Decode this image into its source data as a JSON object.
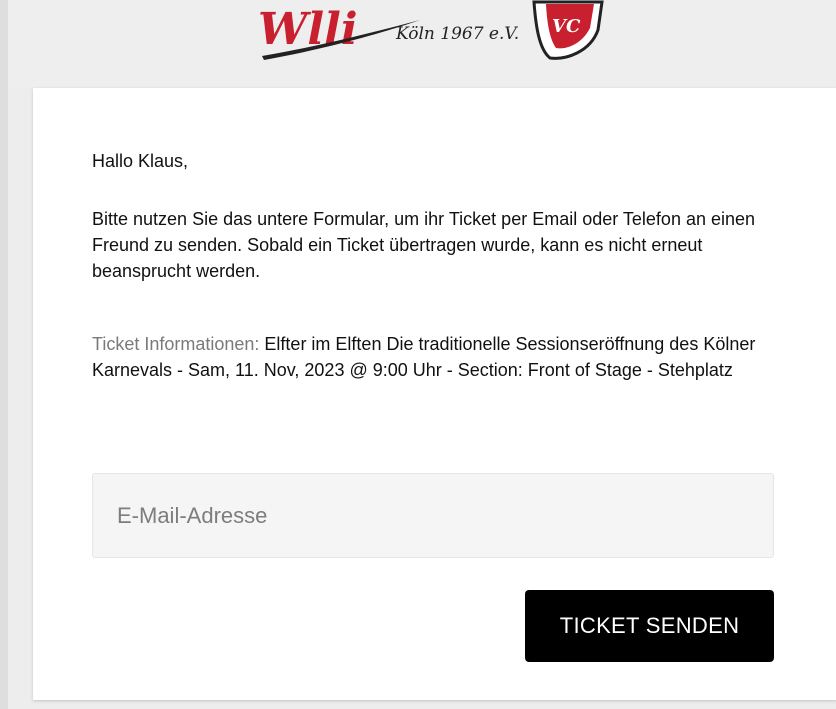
{
  "header": {
    "logo": {
      "tagline": "Köln 1967 e.V.",
      "colors": {
        "primary": "#c8202e",
        "ink": "#222222"
      }
    }
  },
  "card": {
    "greeting": "Hallo Klaus,",
    "intro": "Bitte nutzen Sie das untere Formular, um ihr Ticket per Email oder Telefon an einen Freund zu senden. Sobald ein Ticket übertragen wurde, kann es nicht erneut beansprucht werden.",
    "ticket_info_label": "Ticket Informationen:",
    "ticket_info_value": "Elfter im Elften Die traditionelle Sessionseröffnung des Kölner Karnevals - Sam, 11. Nov, 2023 @ 9:00 Uhr - Section: Front of Stage - Stehplatz",
    "email_field": {
      "placeholder": "E-Mail-Adresse",
      "value": ""
    },
    "send_button_label": "TICKET SENDEN"
  },
  "colors": {
    "page_bg": "#ededed",
    "card_bg": "#ffffff",
    "button_bg": "#000000",
    "button_text": "#ffffff",
    "label_gray": "#7a7a7a"
  }
}
